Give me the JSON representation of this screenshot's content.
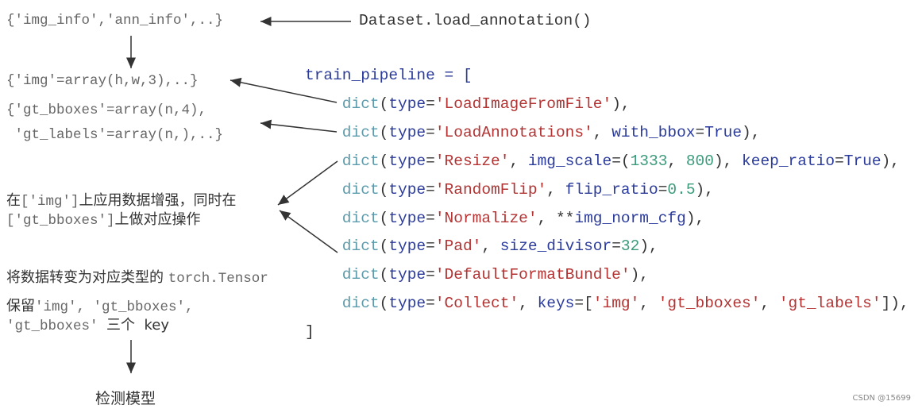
{
  "left": {
    "img_info": "{'img_info','ann_info',..}",
    "load_call": "Dataset.load_annotation()",
    "img_array": "{'img'=array(h,w,3),..}",
    "gt_bboxes": "{'gt_bboxes'=array(n,4),",
    "gt_labels": " 'gt_labels'=array(n,),..}",
    "aug_zh1": "在",
    "aug_code1": "['img']",
    "aug_zh2": "上应用数据增强，同时在",
    "aug_code2": "['gt_bboxes']",
    "aug_zh3": "上做对应操作",
    "tensor_zh": "将数据转变为对应类型的 ",
    "tensor_code": "torch.Tensor",
    "keep_zh": "保留",
    "keep_code1": "'img', 'gt_bboxes',",
    "keep_code2": "'gt_bboxes' ",
    "keep_zh2": "三个  key",
    "model": "检测模型"
  },
  "code_lines": [
    [
      [
        "kw",
        "train_pipeline = ["
      ]
    ],
    [
      [
        "fn",
        "    dict"
      ],
      [
        "pl",
        "("
      ],
      [
        "kw",
        "type"
      ],
      [
        "pl",
        "="
      ],
      [
        "st",
        "'LoadImageFromFile'"
      ],
      [
        "pl",
        "),"
      ]
    ],
    [
      [
        "fn",
        "    dict"
      ],
      [
        "pl",
        "("
      ],
      [
        "kw",
        "type"
      ],
      [
        "pl",
        "="
      ],
      [
        "st",
        "'LoadAnnotations'"
      ],
      [
        "pl",
        ", "
      ],
      [
        "kw",
        "with_bbox"
      ],
      [
        "pl",
        "="
      ],
      [
        "kw",
        "True"
      ],
      [
        "pl",
        "),"
      ]
    ],
    [
      [
        "fn",
        "    dict"
      ],
      [
        "pl",
        "("
      ],
      [
        "kw",
        "type"
      ],
      [
        "pl",
        "="
      ],
      [
        "st",
        "'Resize'"
      ],
      [
        "pl",
        ", "
      ],
      [
        "kw",
        "img_scale"
      ],
      [
        "pl",
        "=("
      ],
      [
        "nu",
        "1333"
      ],
      [
        "pl",
        ", "
      ],
      [
        "nu",
        "800"
      ],
      [
        "pl",
        "), "
      ],
      [
        "kw",
        "keep_ratio"
      ],
      [
        "pl",
        "="
      ],
      [
        "kw",
        "True"
      ],
      [
        "pl",
        "),"
      ]
    ],
    [
      [
        "fn",
        "    dict"
      ],
      [
        "pl",
        "("
      ],
      [
        "kw",
        "type"
      ],
      [
        "pl",
        "="
      ],
      [
        "st",
        "'RandomFlip'"
      ],
      [
        "pl",
        ", "
      ],
      [
        "kw",
        "flip_ratio"
      ],
      [
        "pl",
        "="
      ],
      [
        "nu",
        "0.5"
      ],
      [
        "pl",
        "),"
      ]
    ],
    [
      [
        "fn",
        "    dict"
      ],
      [
        "pl",
        "("
      ],
      [
        "kw",
        "type"
      ],
      [
        "pl",
        "="
      ],
      [
        "st",
        "'Normalize'"
      ],
      [
        "pl",
        ", **"
      ],
      [
        "kw",
        "img_norm_cfg"
      ],
      [
        "pl",
        "),"
      ]
    ],
    [
      [
        "fn",
        "    dict"
      ],
      [
        "pl",
        "("
      ],
      [
        "kw",
        "type"
      ],
      [
        "pl",
        "="
      ],
      [
        "st",
        "'Pad'"
      ],
      [
        "pl",
        ", "
      ],
      [
        "kw",
        "size_divisor"
      ],
      [
        "pl",
        "="
      ],
      [
        "nu",
        "32"
      ],
      [
        "pl",
        "),"
      ]
    ],
    [
      [
        "fn",
        "    dict"
      ],
      [
        "pl",
        "("
      ],
      [
        "kw",
        "type"
      ],
      [
        "pl",
        "="
      ],
      [
        "st",
        "'DefaultFormatBundle'"
      ],
      [
        "pl",
        "),"
      ]
    ],
    [
      [
        "fn",
        "    dict"
      ],
      [
        "pl",
        "("
      ],
      [
        "kw",
        "type"
      ],
      [
        "pl",
        "="
      ],
      [
        "st",
        "'Collect'"
      ],
      [
        "pl",
        ", "
      ],
      [
        "kw",
        "keys"
      ],
      [
        "pl",
        "=["
      ],
      [
        "st",
        "'img'"
      ],
      [
        "pl",
        ", "
      ],
      [
        "st",
        "'gt_bboxes'"
      ],
      [
        "pl",
        ", "
      ],
      [
        "st",
        "'gt_labels'"
      ],
      [
        "pl",
        "]),"
      ]
    ],
    [
      [
        "pl",
        "]"
      ]
    ]
  ],
  "watermark": "CSDN @15699",
  "colors": {
    "keyword": "#2b3b9b",
    "function": "#5b9bab",
    "string": "#b33232",
    "number": "#3b9b7b"
  }
}
